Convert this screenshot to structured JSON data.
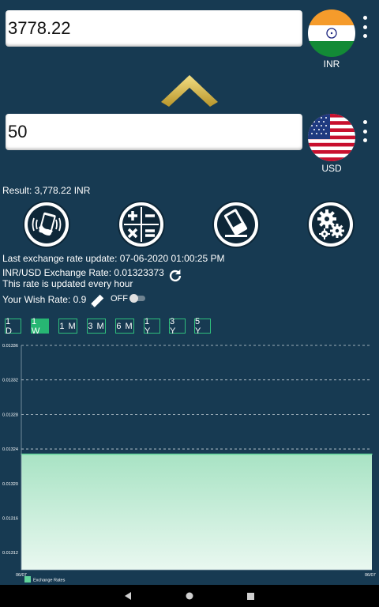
{
  "converter": {
    "top": {
      "value": "3778.22",
      "currency": "INR",
      "flag_icon": "india-flag-icon"
    },
    "bottom": {
      "value": "50",
      "currency": "USD",
      "flag_icon": "usa-flag-icon"
    },
    "swap_icon": "chevron-up-icon"
  },
  "result_text": "Result: 3,778.22 INR",
  "tools": [
    {
      "name": "shake-phone-icon"
    },
    {
      "name": "calculator-icon"
    },
    {
      "name": "eraser-icon"
    },
    {
      "name": "gears-icon"
    }
  ],
  "info": {
    "last_update": "Last exchange rate update: 07-06-2020 01:00:25 PM",
    "rate_line": "INR/USD Exchange Rate: 0.01323373",
    "update_freq": "This rate is updated every hour",
    "wish_rate": "Your Wish Rate: 0.9",
    "toggle_label": "OFF",
    "toggle_on": false
  },
  "ranges": [
    {
      "label": "1 D",
      "active": false
    },
    {
      "label": "1 W",
      "active": true
    },
    {
      "label": "1 M",
      "active": false
    },
    {
      "label": "3 M",
      "active": false
    },
    {
      "label": "6 M",
      "active": false
    },
    {
      "label": "1 Y",
      "active": false
    },
    {
      "label": "3 Y",
      "active": false
    },
    {
      "label": "5 Y",
      "active": false
    }
  ],
  "chart_data": {
    "type": "area",
    "x": [
      "06/07",
      "06/07"
    ],
    "series": [
      {
        "name": "Exchange Rates",
        "values": [
          0.013234,
          0.013234
        ]
      }
    ],
    "y_ticks": [
      "0.01336",
      "0.01332",
      "0.01328",
      "0.01324",
      "0.01320",
      "0.01316",
      "0.01312"
    ],
    "x_tick_labels": [
      "06/07",
      "06/07"
    ],
    "ylim": [
      0.0131,
      0.01336
    ],
    "grid": true,
    "legend": "bottom-left",
    "line_color": "#5fd39a",
    "fill_top": "#a8e3c4",
    "fill_bottom": "#e9f8f0"
  },
  "colors": {
    "background": "#173a52",
    "accent": "#27b673"
  }
}
